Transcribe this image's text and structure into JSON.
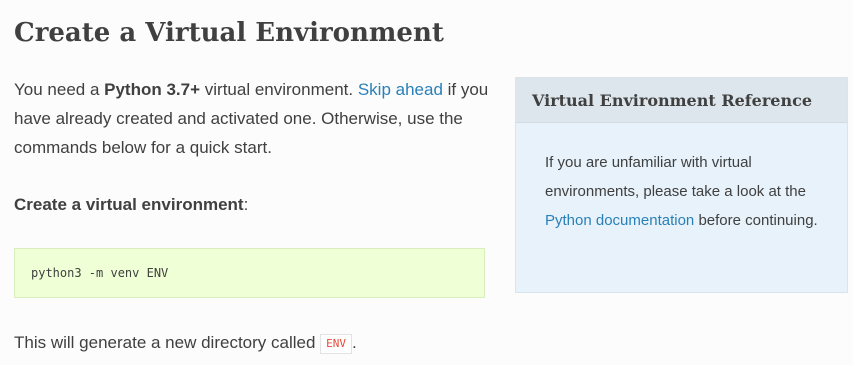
{
  "heading": "Create a Virtual Environment",
  "intro": {
    "before": "You need a ",
    "bold": "Python 3.7+",
    "middle": " virtual environment. ",
    "link": "Skip ahead",
    "after": " if you have already created and activated one. Otherwise, use the commands below for a quick start."
  },
  "subheading": {
    "bold": "Create a virtual environment",
    "after": ":"
  },
  "code": "python3 -m venv ENV",
  "note": {
    "before": "This will generate a new directory called ",
    "code": "ENV",
    "after": "."
  },
  "sidebar": {
    "title": "Virtual Environment Reference",
    "before": "If you are unfamiliar with virtual environments, please take a look at the ",
    "link": "Python documentation",
    "after": " before continuing."
  },
  "colors": {
    "text": "#404040",
    "link": "#2980b9",
    "code_bg": "#efffd6",
    "inline_code": "#e74c3c",
    "sidebar_bg": "#e7f2fa"
  }
}
